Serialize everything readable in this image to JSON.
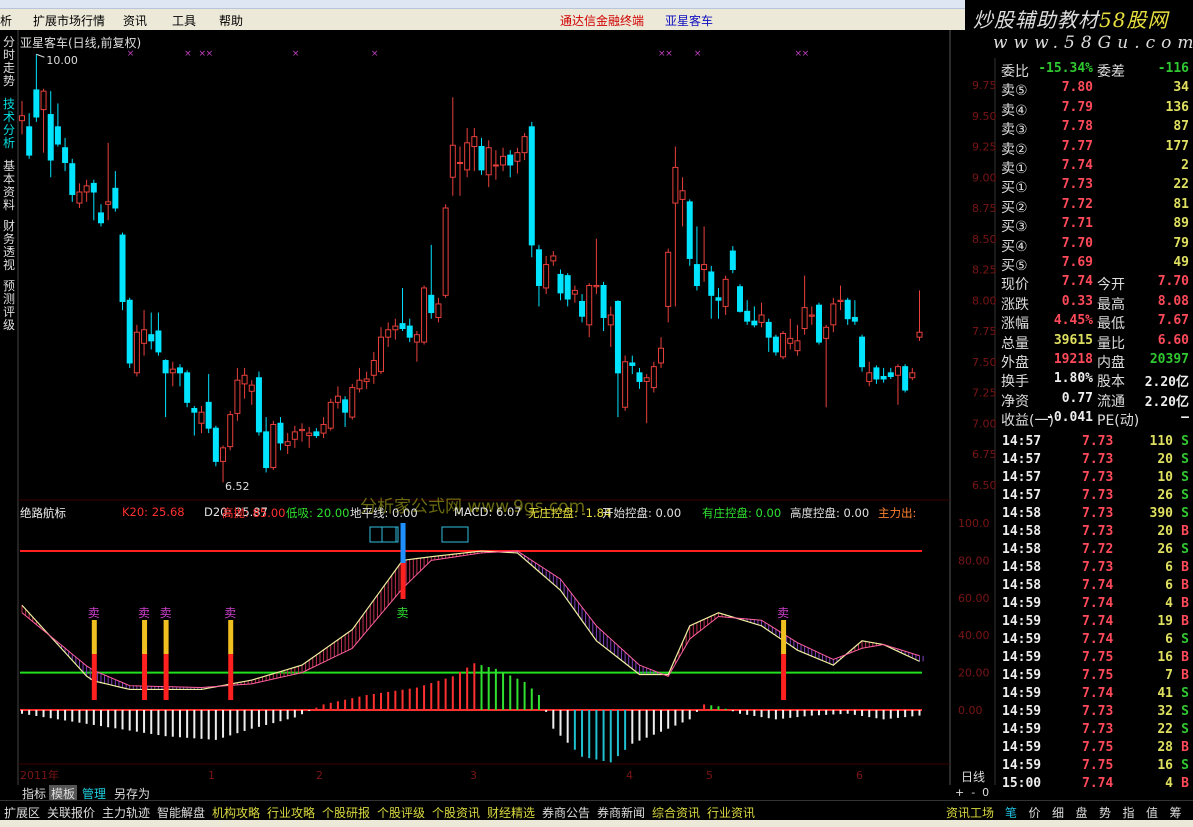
{
  "menu": {
    "items": [
      "析",
      "扩展市场行情",
      "资讯",
      "工具",
      "帮助"
    ],
    "app_title": "通达信金融终端",
    "stock_title": "亚星客车"
  },
  "brand": {
    "line1a": "炒股辅助教材",
    "line1b": "58股网",
    "line2": "www.58Gu.com"
  },
  "vtabs": [
    "分时走势",
    "技术分析",
    "基本资料",
    "财务透视",
    "预测评级"
  ],
  "chart": {
    "title": "亚星客车(日线,前复权)",
    "high_label": "10.00",
    "low_label": "6.52",
    "watermark": "分析家公式网 www.9gs.com",
    "price_axis": [
      "9.75",
      "9.50",
      "9.25",
      "9.00",
      "8.75",
      "8.50",
      "8.25",
      "8.00",
      "7.75",
      "7.50",
      "7.25",
      "7.00",
      "6.75",
      "6.50"
    ],
    "ind_axis": [
      "100.0",
      "80.00",
      "60.00",
      "40.00",
      "20.00",
      "0.00"
    ],
    "date_labels": [
      "2011年",
      "1",
      "2",
      "3",
      "4",
      "5",
      "6"
    ],
    "signal_label": "卖",
    "colors": {
      "up": "#e8403c",
      "down": "#00e4ff",
      "hi_line": "#ff2020",
      "lo_line": "#20e020"
    },
    "candles": [
      [
        9.46,
        9.62,
        9.35,
        9.5
      ],
      [
        9.41,
        9.52,
        9.15,
        9.18
      ],
      [
        9.71,
        10.0,
        9.45,
        9.49
      ],
      [
        9.55,
        9.72,
        9.2,
        9.7
      ],
      [
        9.51,
        9.7,
        9.0,
        9.14
      ],
      [
        9.41,
        9.6,
        9.25,
        9.27
      ],
      [
        9.24,
        9.32,
        9.05,
        9.12
      ],
      [
        9.11,
        9.15,
        8.8,
        8.86
      ],
      [
        8.79,
        8.95,
        8.75,
        8.88
      ],
      [
        8.88,
        8.98,
        8.8,
        8.93
      ],
      [
        8.95,
        8.98,
        8.65,
        8.88
      ],
      [
        8.71,
        8.78,
        8.6,
        8.63
      ],
      [
        8.78,
        9.28,
        8.65,
        8.8
      ],
      [
        8.91,
        9.05,
        8.72,
        8.75
      ],
      [
        8.53,
        8.55,
        7.92,
        7.99
      ],
      [
        8.0,
        8.02,
        7.45,
        7.49
      ],
      [
        7.41,
        7.8,
        7.38,
        7.74
      ],
      [
        7.65,
        7.92,
        7.55,
        7.76
      ],
      [
        7.72,
        7.9,
        7.6,
        7.67
      ],
      [
        7.75,
        7.9,
        7.55,
        7.58
      ],
      [
        7.51,
        7.52,
        7.05,
        7.41
      ],
      [
        7.41,
        7.5,
        7.3,
        7.44
      ],
      [
        7.45,
        7.48,
        7.3,
        7.41
      ],
      [
        7.41,
        7.43,
        7.13,
        7.17
      ],
      [
        7.12,
        7.14,
        6.9,
        7.09
      ],
      [
        7.0,
        7.14,
        6.92,
        7.09
      ],
      [
        7.17,
        7.4,
        6.92,
        6.96
      ],
      [
        6.96,
        6.98,
        6.65,
        6.69
      ],
      [
        6.69,
        6.82,
        6.52,
        6.8
      ],
      [
        6.81,
        7.1,
        6.78,
        7.07
      ],
      [
        7.08,
        7.45,
        7.02,
        7.35
      ],
      [
        7.32,
        7.45,
        7.2,
        7.39
      ],
      [
        7.26,
        7.35,
        7.15,
        7.31
      ],
      [
        7.37,
        7.42,
        6.9,
        6.93
      ],
      [
        6.93,
        7.05,
        6.6,
        6.64
      ],
      [
        6.64,
        7.02,
        6.62,
        6.99
      ],
      [
        7.0,
        7.05,
        6.78,
        6.84
      ],
      [
        6.82,
        6.92,
        6.75,
        6.85
      ],
      [
        6.87,
        6.98,
        6.8,
        6.93
      ],
      [
        6.94,
        7.0,
        6.85,
        6.95
      ],
      [
        6.9,
        6.97,
        6.8,
        6.92
      ],
      [
        6.93,
        6.96,
        6.88,
        6.9
      ],
      [
        6.92,
        7.05,
        6.88,
        6.99
      ],
      [
        6.96,
        7.2,
        6.94,
        7.17
      ],
      [
        7.17,
        7.3,
        7.12,
        7.22
      ],
      [
        7.19,
        7.22,
        6.97,
        7.09
      ],
      [
        7.05,
        7.32,
        7.03,
        7.29
      ],
      [
        7.28,
        7.45,
        7.25,
        7.35
      ],
      [
        7.34,
        7.42,
        7.28,
        7.36
      ],
      [
        7.39,
        7.58,
        7.32,
        7.51
      ],
      [
        7.42,
        7.78,
        7.4,
        7.7
      ],
      [
        7.7,
        7.82,
        7.62,
        7.76
      ],
      [
        7.76,
        7.85,
        7.68,
        7.79
      ],
      [
        7.81,
        8.1,
        7.75,
        7.77
      ],
      [
        7.79,
        7.85,
        7.66,
        7.7
      ],
      [
        7.66,
        7.75,
        7.5,
        7.72
      ],
      [
        7.66,
        8.12,
        7.64,
        8.1
      ],
      [
        8.04,
        8.45,
        7.85,
        7.9
      ],
      [
        7.86,
        8.02,
        7.82,
        7.97
      ],
      [
        8.04,
        8.78,
        8.02,
        8.75
      ],
      [
        9.0,
        9.65,
        8.85,
        9.26
      ],
      [
        9.12,
        9.25,
        8.85,
        9.12
      ],
      [
        9.06,
        9.4,
        9.0,
        9.28
      ],
      [
        9.25,
        9.4,
        9.05,
        9.33
      ],
      [
        9.25,
        9.32,
        9.02,
        9.06
      ],
      [
        9.02,
        9.3,
        8.92,
        9.24
      ],
      [
        9.1,
        9.22,
        8.98,
        9.1
      ],
      [
        9.1,
        9.24,
        9.05,
        9.17
      ],
      [
        9.18,
        9.22,
        9.0,
        9.1
      ],
      [
        9.13,
        9.24,
        9.03,
        9.2
      ],
      [
        9.2,
        9.36,
        9.14,
        9.33
      ],
      [
        9.41,
        9.45,
        8.35,
        8.45
      ],
      [
        8.41,
        8.45,
        7.95,
        8.12
      ],
      [
        8.1,
        8.36,
        8.05,
        8.29
      ],
      [
        8.32,
        8.4,
        8.28,
        8.36
      ],
      [
        8.21,
        8.25,
        8.0,
        8.06
      ],
      [
        8.2,
        8.22,
        7.95,
        8.01
      ],
      [
        8.05,
        8.12,
        7.98,
        8.08
      ],
      [
        7.99,
        8.05,
        7.82,
        7.87
      ],
      [
        7.8,
        8.14,
        7.7,
        8.12
      ],
      [
        8.11,
        8.5,
        8.05,
        8.12
      ],
      [
        8.12,
        8.15,
        7.75,
        7.86
      ],
      [
        7.8,
        7.95,
        7.62,
        7.88
      ],
      [
        7.99,
        8.0,
        7.05,
        7.41
      ],
      [
        7.13,
        7.55,
        7.1,
        7.5
      ],
      [
        7.49,
        7.55,
        7.4,
        7.47
      ],
      [
        7.41,
        7.45,
        7.28,
        7.34
      ],
      [
        7.34,
        7.4,
        7.0,
        7.37
      ],
      [
        7.29,
        7.5,
        7.25,
        7.46
      ],
      [
        7.49,
        7.7,
        7.45,
        7.61
      ],
      [
        7.95,
        8.42,
        7.82,
        8.39
      ],
      [
        8.79,
        9.25,
        7.95,
        9.08
      ],
      [
        8.82,
        9.0,
        8.6,
        8.89
      ],
      [
        8.8,
        8.82,
        8.28,
        8.34
      ],
      [
        8.29,
        8.6,
        8.08,
        8.12
      ],
      [
        8.25,
        8.6,
        8.15,
        8.29
      ],
      [
        8.23,
        8.28,
        7.85,
        8.04
      ],
      [
        8.02,
        8.1,
        7.85,
        8.0
      ],
      [
        7.95,
        8.2,
        7.88,
        8.17
      ],
      [
        8.4,
        8.44,
        8.22,
        8.25
      ],
      [
        8.11,
        8.13,
        7.9,
        7.91
      ],
      [
        7.91,
        8.0,
        7.8,
        7.83
      ],
      [
        7.83,
        7.95,
        7.78,
        7.8
      ],
      [
        7.82,
        7.98,
        7.78,
        7.88
      ],
      [
        7.82,
        7.85,
        7.58,
        7.7
      ],
      [
        7.7,
        7.72,
        7.55,
        7.58
      ],
      [
        7.54,
        7.75,
        7.52,
        7.73
      ],
      [
        7.65,
        7.85,
        7.6,
        7.69
      ],
      [
        7.59,
        7.8,
        7.55,
        7.67
      ],
      [
        7.77,
        8.2,
        7.72,
        7.94
      ],
      [
        7.87,
        7.95,
        7.8,
        7.88
      ],
      [
        7.96,
        7.98,
        7.64,
        7.66
      ],
      [
        7.69,
        7.8,
        7.13,
        7.78
      ],
      [
        7.8,
        8.02,
        7.74,
        7.97
      ],
      [
        7.99,
        8.12,
        7.92,
        8.0
      ],
      [
        8.0,
        8.02,
        7.8,
        7.85
      ],
      [
        7.86,
        8.0,
        7.8,
        7.83
      ],
      [
        7.7,
        7.72,
        7.42,
        7.46
      ],
      [
        7.34,
        7.5,
        7.3,
        7.41
      ],
      [
        7.45,
        7.47,
        7.32,
        7.36
      ],
      [
        7.38,
        7.45,
        7.33,
        7.36
      ],
      [
        7.41,
        7.45,
        7.36,
        7.38
      ],
      [
        7.39,
        7.48,
        7.15,
        7.46
      ],
      [
        7.46,
        7.48,
        7.25,
        7.27
      ],
      [
        7.37,
        7.45,
        7.35,
        7.41
      ],
      [
        7.7,
        8.08,
        7.67,
        7.74
      ]
    ],
    "markers": [
      15,
      23,
      25,
      26,
      38,
      49,
      89,
      90,
      94,
      108,
      109
    ],
    "k_points": [
      [
        0,
        56
      ],
      [
        9.5,
        16
      ],
      [
        15,
        11
      ],
      [
        25,
        11
      ],
      [
        32,
        16
      ],
      [
        39,
        24
      ],
      [
        46,
        43
      ],
      [
        53,
        80
      ],
      [
        57,
        82
      ],
      [
        64,
        85
      ],
      [
        69,
        84
      ],
      [
        75,
        64
      ],
      [
        80,
        37
      ],
      [
        86,
        19
      ],
      [
        90,
        19
      ],
      [
        93,
        45
      ],
      [
        97,
        52
      ],
      [
        103,
        45
      ],
      [
        108,
        32
      ],
      [
        113,
        24
      ],
      [
        117,
        37
      ],
      [
        120,
        35
      ],
      [
        125,
        26
      ]
    ],
    "d_points": [
      [
        0,
        52
      ],
      [
        9.5,
        22
      ],
      [
        15,
        13
      ],
      [
        25,
        12
      ],
      [
        32,
        14
      ],
      [
        39,
        20
      ],
      [
        46,
        33
      ],
      [
        53,
        65
      ],
      [
        57,
        80
      ],
      [
        64,
        84
      ],
      [
        69,
        85
      ],
      [
        75,
        70
      ],
      [
        80,
        45
      ],
      [
        86,
        24
      ],
      [
        90,
        18
      ],
      [
        93,
        38
      ],
      [
        97,
        50
      ],
      [
        103,
        48
      ],
      [
        108,
        36
      ],
      [
        113,
        27
      ],
      [
        117,
        33
      ],
      [
        120,
        35
      ],
      [
        125,
        29
      ]
    ],
    "macd_points": [
      [
        0,
        -2
      ],
      [
        10,
        -8
      ],
      [
        20,
        -14
      ],
      [
        27,
        -16
      ],
      [
        32,
        -10
      ],
      [
        38,
        -4
      ],
      [
        42,
        3
      ],
      [
        48,
        8
      ],
      [
        55,
        12
      ],
      [
        60,
        18
      ],
      [
        63,
        25
      ],
      [
        66,
        22
      ],
      [
        70,
        15
      ],
      [
        72,
        8
      ],
      [
        74,
        -10
      ],
      [
        78,
        -25
      ],
      [
        82,
        -28
      ],
      [
        85,
        -18
      ],
      [
        90,
        -10
      ],
      [
        93,
        -5
      ],
      [
        95,
        3
      ],
      [
        97,
        2
      ],
      [
        100,
        -2
      ],
      [
        105,
        -5
      ],
      [
        110,
        -3
      ],
      [
        115,
        -2
      ],
      [
        120,
        -5
      ],
      [
        125,
        -3
      ]
    ],
    "signals": [
      10,
      17,
      20,
      29,
      53,
      106
    ],
    "high_line": 85,
    "low_line": 20
  },
  "indicator": {
    "name": "绝路航标",
    "items": [
      {
        "t": "K20: 25.68",
        "c": "#ff3030"
      },
      {
        "t": "D20: 25.87",
        "c": "#e0e0e0"
      },
      {
        "t": "高抛: 85.00",
        "c": "#ff3030"
      },
      {
        "t": "低吸: 20.00",
        "c": "#30e030"
      },
      {
        "t": "地平线: 0.00",
        "c": "#e0e0e0"
      },
      {
        "t": "MACD: 6.07",
        "c": "#e0e0e0"
      },
      {
        "t": "无庄控盘: -1.84",
        "c": "#e8e040"
      },
      {
        "t": "开始控盘: 0.00",
        "c": "#e0e0e0"
      },
      {
        "t": "有庄控盘: 0.00",
        "c": "#30e030"
      },
      {
        "t": "高度控盘: 0.00",
        "c": "#e0e0e0"
      },
      {
        "t": "主力出:",
        "c": "#ff8030"
      }
    ]
  },
  "quote": {
    "rows": [
      {
        "l1": "委比",
        "v1": "-15.34%",
        "c1": "grn",
        "l2": "委差",
        "v2": "-116",
        "c2": "grn"
      },
      {
        "l1": "卖⑤",
        "v1": "7.80",
        "c1": "red",
        "v2": "34",
        "c2": "yel"
      },
      {
        "l1": "卖④",
        "v1": "7.79",
        "c1": "red",
        "v2": "136",
        "c2": "yel"
      },
      {
        "l1": "卖③",
        "v1": "7.78",
        "c1": "red",
        "v2": "87",
        "c2": "yel"
      },
      {
        "l1": "卖②",
        "v1": "7.77",
        "c1": "red",
        "v2": "177",
        "c2": "yel"
      },
      {
        "l1": "卖①",
        "v1": "7.74",
        "c1": "red",
        "v2": "2",
        "c2": "yel"
      },
      {
        "l1": "买①",
        "v1": "7.73",
        "c1": "red",
        "v2": "22",
        "c2": "yel"
      },
      {
        "l1": "买②",
        "v1": "7.72",
        "c1": "red",
        "v2": "81",
        "c2": "yel"
      },
      {
        "l1": "买③",
        "v1": "7.71",
        "c1": "red",
        "v2": "89",
        "c2": "yel"
      },
      {
        "l1": "买④",
        "v1": "7.70",
        "c1": "red",
        "v2": "79",
        "c2": "yel"
      },
      {
        "l1": "买⑤",
        "v1": "7.69",
        "c1": "red",
        "v2": "49",
        "c2": "yel"
      },
      {
        "l1": "现价",
        "v1": "7.74",
        "c1": "red",
        "l2": "今开",
        "v2": "7.70",
        "c2": "red"
      },
      {
        "l1": "涨跌",
        "v1": "0.33",
        "c1": "red",
        "l2": "最高",
        "v2": "8.08",
        "c2": "red"
      },
      {
        "l1": "涨幅",
        "v1": "4.45%",
        "c1": "red",
        "l2": "最低",
        "v2": "7.67",
        "c2": "red"
      },
      {
        "l1": "总量",
        "v1": "39615",
        "c1": "yel",
        "l2": "量比",
        "v2": "6.60",
        "c2": "red"
      },
      {
        "l1": "外盘",
        "v1": "19218",
        "c1": "red",
        "l2": "内盘",
        "v2": "20397",
        "c2": "grn"
      },
      {
        "l1": "换手",
        "v1": "1.80%",
        "c1": "wht",
        "l2": "股本",
        "v2": "2.20亿",
        "c2": "wht"
      },
      {
        "l1": "净资",
        "v1": "0.77",
        "c1": "wht",
        "l2": "流通",
        "v2": "2.20亿",
        "c2": "wht"
      },
      {
        "l1": "收益(一)",
        "v1": "-0.041",
        "c1": "wht",
        "l2": "PE(动)",
        "v2": "—",
        "c2": "wht"
      }
    ],
    "ticks": [
      [
        "14:57",
        "7.73",
        "110",
        "S"
      ],
      [
        "14:57",
        "7.73",
        "20",
        "S"
      ],
      [
        "14:57",
        "7.73",
        "10",
        "S"
      ],
      [
        "14:57",
        "7.73",
        "26",
        "S"
      ],
      [
        "14:58",
        "7.73",
        "390",
        "S"
      ],
      [
        "14:58",
        "7.73",
        "20",
        "B"
      ],
      [
        "14:58",
        "7.72",
        "26",
        "S"
      ],
      [
        "14:58",
        "7.73",
        "6",
        "B"
      ],
      [
        "14:58",
        "7.74",
        "6",
        "B"
      ],
      [
        "14:59",
        "7.74",
        "4",
        "B"
      ],
      [
        "14:59",
        "7.74",
        "19",
        "B"
      ],
      [
        "14:59",
        "7.74",
        "6",
        "S"
      ],
      [
        "14:59",
        "7.75",
        "16",
        "B"
      ],
      [
        "14:59",
        "7.75",
        "7",
        "B"
      ],
      [
        "14:59",
        "7.74",
        "41",
        "S"
      ],
      [
        "14:59",
        "7.73",
        "32",
        "S"
      ],
      [
        "14:59",
        "7.73",
        "22",
        "S"
      ],
      [
        "14:59",
        "7.75",
        "28",
        "B"
      ],
      [
        "14:59",
        "7.75",
        "16",
        "S"
      ],
      [
        "15:00",
        "7.74",
        "4",
        "B"
      ]
    ]
  },
  "period": {
    "label": "日线",
    "zoom": "+  -  0"
  },
  "bottom_tabs": [
    "指标",
    "模板",
    "管理",
    "另存为"
  ],
  "bottom_bar": {
    "items": [
      {
        "t": "扩展区",
        "c": "#ddd"
      },
      {
        "t": "关联报价",
        "c": "#ddd"
      },
      {
        "t": "主力轨迹",
        "c": "#ddd"
      },
      {
        "t": "智能解盘",
        "c": "#ddd"
      },
      {
        "t": "机构攻略",
        "c": "#d8d840"
      },
      {
        "t": "行业攻略",
        "c": "#d8d840"
      },
      {
        "t": "个股研报",
        "c": "#d8d840"
      },
      {
        "t": "个股评级",
        "c": "#d8d840"
      },
      {
        "t": "个股资讯",
        "c": "#d8d840"
      },
      {
        "t": "财经精选",
        "c": "#d8d840"
      },
      {
        "t": "券商公告",
        "c": "#ddd"
      },
      {
        "t": "券商新闻",
        "c": "#ddd"
      },
      {
        "t": "综合资讯",
        "c": "#d8d840"
      },
      {
        "t": "行业资讯",
        "c": "#d8d840"
      }
    ],
    "right_label": "资讯工场",
    "right_tabs": [
      "笔",
      "价",
      "细",
      "盘",
      "势",
      "指",
      "值",
      "筹"
    ]
  }
}
